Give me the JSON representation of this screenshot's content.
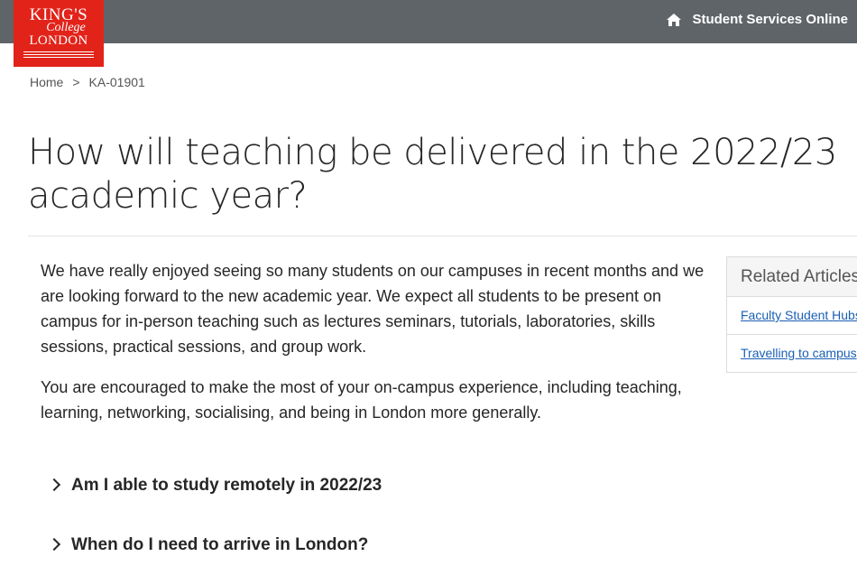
{
  "header": {
    "logo": {
      "line1": "KING'S",
      "line2": "College",
      "line3": "LONDON"
    },
    "nav_link": {
      "icon": "home-icon",
      "label": "Student Services Online"
    },
    "bar_color": "#5f6468",
    "logo_color": "#e2231a"
  },
  "breadcrumb": {
    "home": "Home",
    "separator": ">",
    "current": "KA-01901"
  },
  "page_title": "How will teaching be delivered in the 2022/23 academic year?",
  "body": {
    "paragraphs": [
      "We have really enjoyed seeing so many students on our campuses in recent months and we are looking forward to the new academic year. We expect all students to be present on campus for in-person teaching such as lectures seminars, tutorials, laboratories, skills sessions, practical sessions, and group work.",
      "You are encouraged to make the most of your on-campus experience, including teaching, learning, networking, socialising, and being in London more generally."
    ]
  },
  "accordion": [
    {
      "label": "Am I able to study remotely in 2022/23"
    },
    {
      "label": "When do I need to arrive in London?"
    }
  ],
  "related": {
    "title": "Related Articles",
    "links": [
      "Faculty Student Hubs",
      "Travelling to campus"
    ]
  }
}
